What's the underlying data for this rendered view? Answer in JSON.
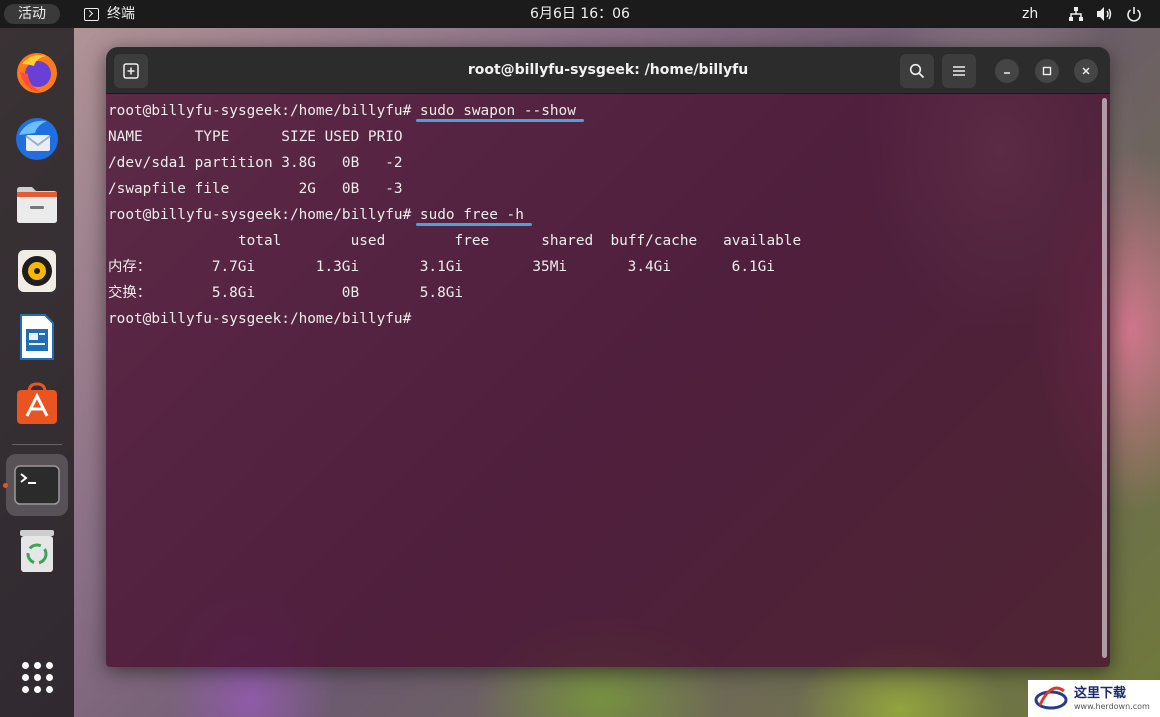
{
  "topbar": {
    "activities": "活动",
    "app_name": "终端",
    "clock": "6月6日  16：06",
    "lang": "zh",
    "icons": [
      "network-icon",
      "volume-icon",
      "power-icon"
    ]
  },
  "dock": {
    "apps": [
      "firefox",
      "thunderbird",
      "files",
      "rhythmbox",
      "libreoffice-writer",
      "app-center",
      "terminal",
      "trash",
      "show-apps"
    ],
    "active_app": "terminal",
    "accent": "#e95420"
  },
  "window": {
    "title": "root@billyfu-sysgeek: /home/billyfu",
    "buttons": [
      "new-tab",
      "search",
      "menu",
      "minimize",
      "maximize",
      "close"
    ]
  },
  "terminal": {
    "prompt": "root@billyfu-sysgeek:/home/billyfu# ",
    "cmd1": "sudo swapon --show",
    "swapon_header": "NAME      TYPE      SIZE USED PRIO",
    "swapon_row1": "/dev/sda1 partition 3.8G   0B   -2",
    "swapon_row2": "/swapfile file        2G   0B   -3",
    "cmd2": "sudo free -h",
    "free_header": "               total        used        free      shared  buff/cache   available",
    "free_mem": "内存：       7.7Gi       1.3Gi       3.1Gi        35Mi       3.4Gi       6.1Gi",
    "free_swap": "交换：       5.8Gi          0B       5.8Gi",
    "final_prompt": "root@billyfu-sysgeek:/home/billyfu#",
    "highlight_color": "#4aa3d8",
    "background": "#460e30"
  },
  "watermark": {
    "main": "这里下载",
    "sub": "www.herdown.com"
  }
}
